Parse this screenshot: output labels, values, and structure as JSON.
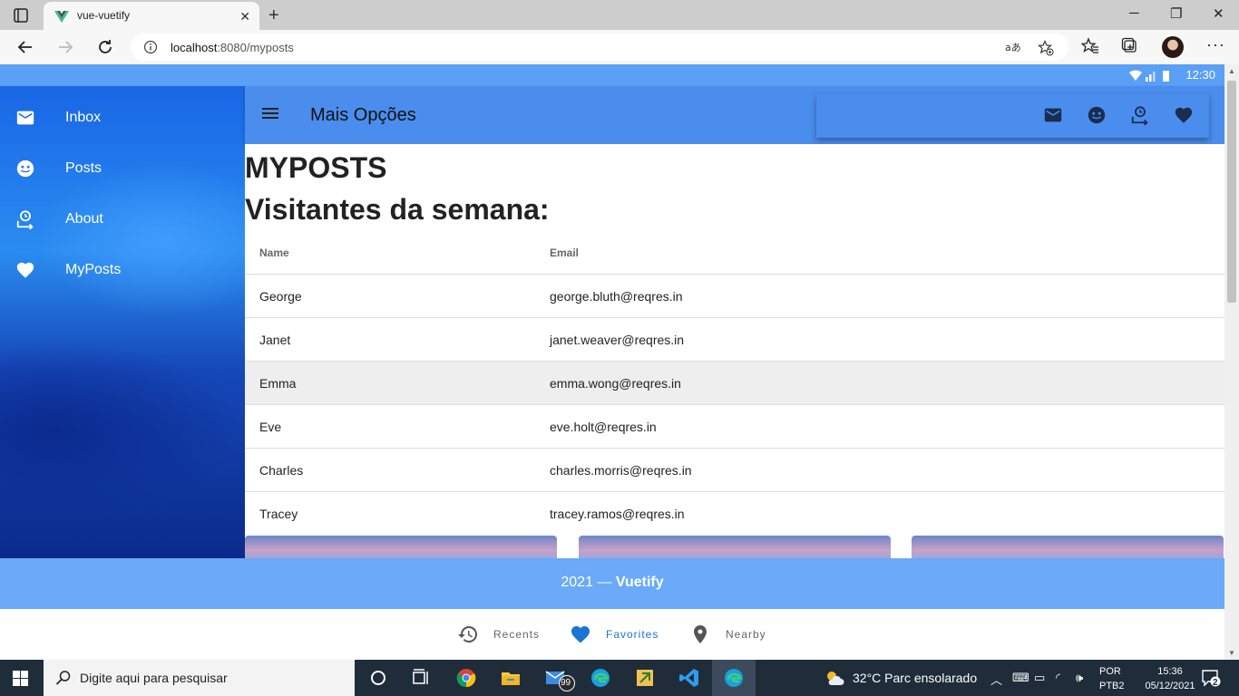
{
  "browser": {
    "tab_title": "vue-vuetify",
    "url_host": "localhost",
    "url_rest": ":8080/myposts",
    "new_tab": "+",
    "tab_close": "✕",
    "minimize": "─",
    "maximize": "❐",
    "close": "✕",
    "more": "···"
  },
  "status": {
    "time": "12:30"
  },
  "drawer": {
    "items": [
      {
        "label": "Inbox",
        "icon": "mail-icon"
      },
      {
        "label": "Posts",
        "icon": "emoticon-icon"
      },
      {
        "label": "About",
        "icon": "account-clock-icon"
      },
      {
        "label": "MyPosts",
        "icon": "heart-icon"
      }
    ]
  },
  "appbar": {
    "title": "Mais Opções"
  },
  "page": {
    "heading": "MYPOSTS",
    "subheading": "Visitantes da semana:",
    "table": {
      "columns": [
        "Name",
        "Email"
      ],
      "rows": [
        {
          "name": "George",
          "email": "george.bluth@reqres.in"
        },
        {
          "name": "Janet",
          "email": "janet.weaver@reqres.in"
        },
        {
          "name": "Emma",
          "email": "emma.wong@reqres.in"
        },
        {
          "name": "Eve",
          "email": "eve.holt@reqres.in"
        },
        {
          "name": "Charles",
          "email": "charles.morris@reqres.in"
        },
        {
          "name": "Tracey",
          "email": "tracey.ramos@reqres.in"
        }
      ],
      "highlighted_row": "Emma"
    }
  },
  "footer": {
    "year_text": "2021 — ",
    "brand": "Vuetify"
  },
  "bottom_nav": [
    {
      "label": "Recents",
      "icon": "history-icon",
      "active": false
    },
    {
      "label": "Favorites",
      "icon": "heart-icon",
      "active": true
    },
    {
      "label": "Nearby",
      "icon": "map-marker-icon",
      "active": false
    }
  ],
  "taskbar": {
    "search_placeholder": "Digite aqui para pesquisar",
    "mail_badge": "99",
    "weather": "32°C  Parc ensolarado",
    "lang_top": "POR",
    "lang_bottom": "PTB2",
    "time": "15:36",
    "date": "05/12/2021",
    "notifications": "2"
  },
  "colors": {
    "appbar": "#4a8ded",
    "footer": "#6aaaf8",
    "active_nav": "#1976d2"
  }
}
